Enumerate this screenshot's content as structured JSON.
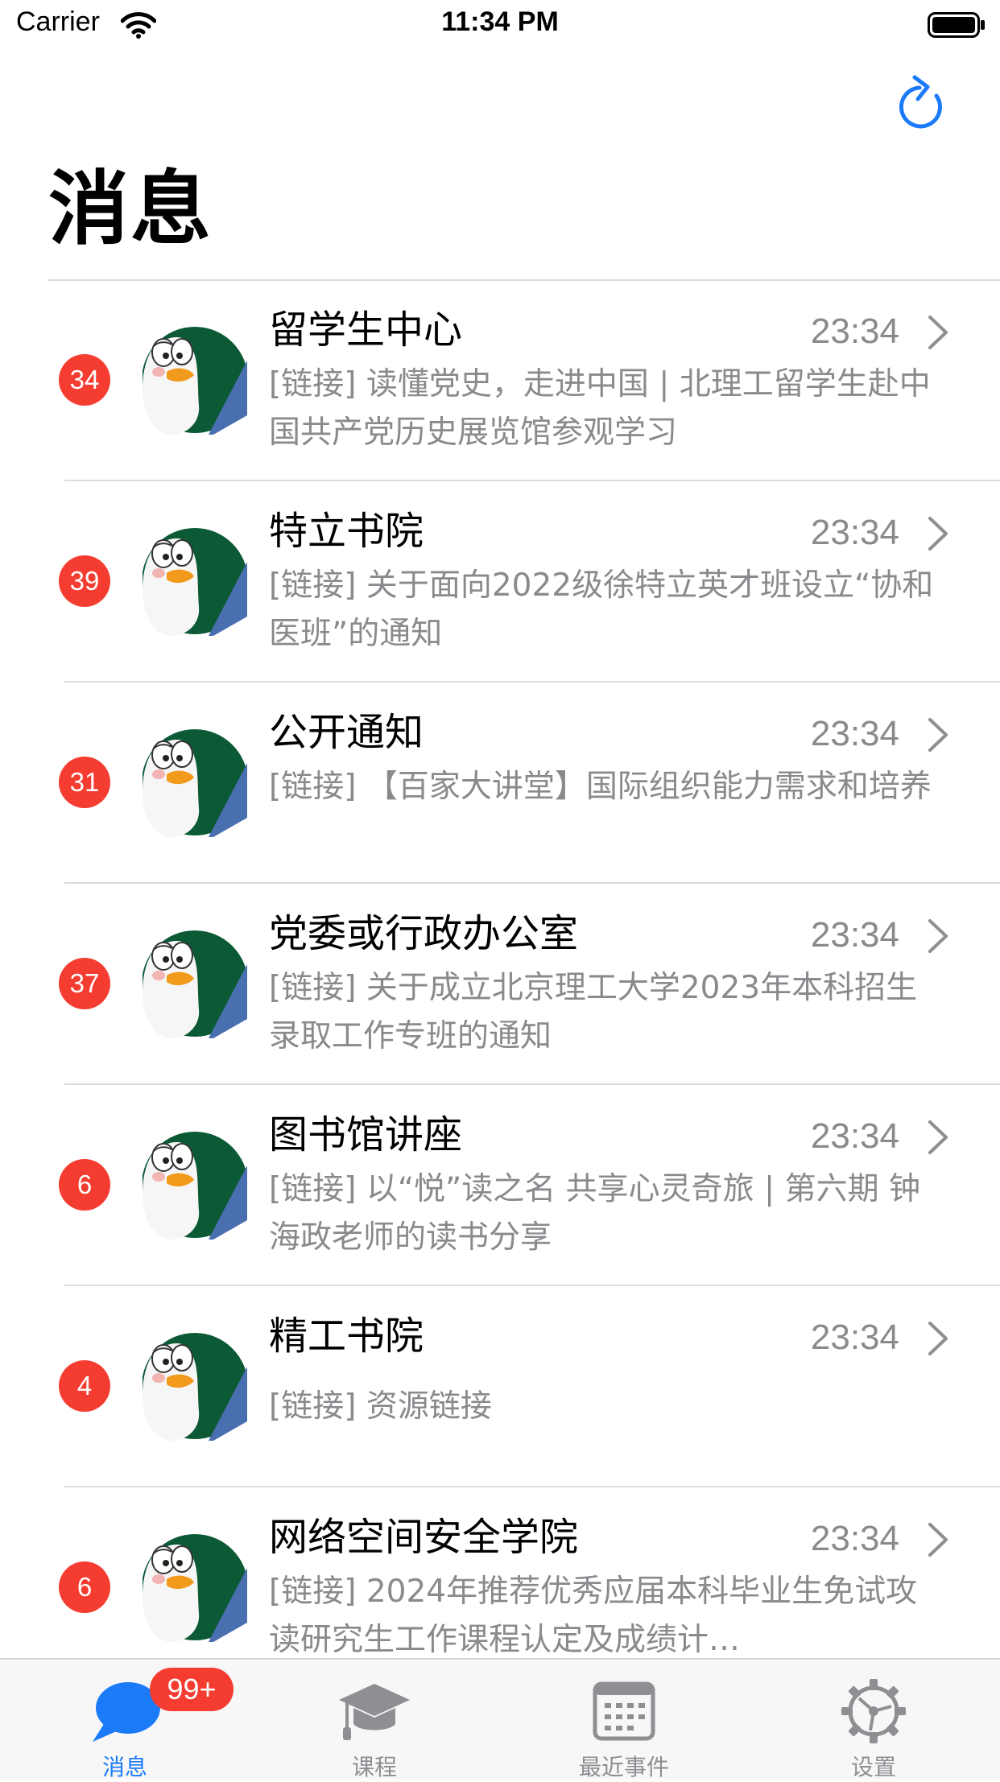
{
  "status_bar": {
    "carrier": "Carrier",
    "time": "11:34 PM"
  },
  "header": {
    "title": "消息",
    "refresh_icon": "refresh-icon"
  },
  "colors": {
    "accent": "#1a7af8",
    "badge": "#f53c30",
    "secondary_text": "#8a8a8e",
    "avatar_green": "#0c5a35",
    "avatar_blue": "#4a6fb1"
  },
  "messages": [
    {
      "badge": "34",
      "name": "留学生中心",
      "time": "23:34",
      "preview": "[链接] 读懂党史，走进中国 | 北理工留学生赴中国共产党历史展览馆参观学习"
    },
    {
      "badge": "39",
      "name": "特立书院",
      "time": "23:34",
      "preview": "[链接] 关于面向2022级徐特立英才班设立“协和医班”的通知"
    },
    {
      "badge": "31",
      "name": "公开通知",
      "time": "23:34",
      "preview": "[链接] 【百家大讲堂】国际组织能力需求和培养"
    },
    {
      "badge": "37",
      "name": "党委或行政办公室",
      "time": "23:34",
      "preview": "[链接] 关于成立北京理工大学2023年本科招生录取工作专班的通知"
    },
    {
      "badge": "6",
      "name": "图书馆讲座",
      "time": "23:34",
      "preview": "[链接] 以“悦”读之名 共享心灵奇旅 | 第六期 钟海政老师的读书分享"
    },
    {
      "badge": "4",
      "name": "精工书院",
      "time": "23:34",
      "preview": "[链接] 资源链接"
    },
    {
      "badge": "6",
      "name": "网络空间安全学院",
      "time": "23:34",
      "preview": "[链接] 2024年推荐优秀应届本科毕业生免试攻读研究生工作课程认定及成绩计…"
    }
  ],
  "tabs": [
    {
      "label": "消息",
      "icon": "chat-bubble-icon",
      "badge": "99+",
      "active": true
    },
    {
      "label": "课程",
      "icon": "graduation-cap-icon"
    },
    {
      "label": "最近事件",
      "icon": "calendar-icon"
    },
    {
      "label": "设置",
      "icon": "gear-icon"
    }
  ]
}
